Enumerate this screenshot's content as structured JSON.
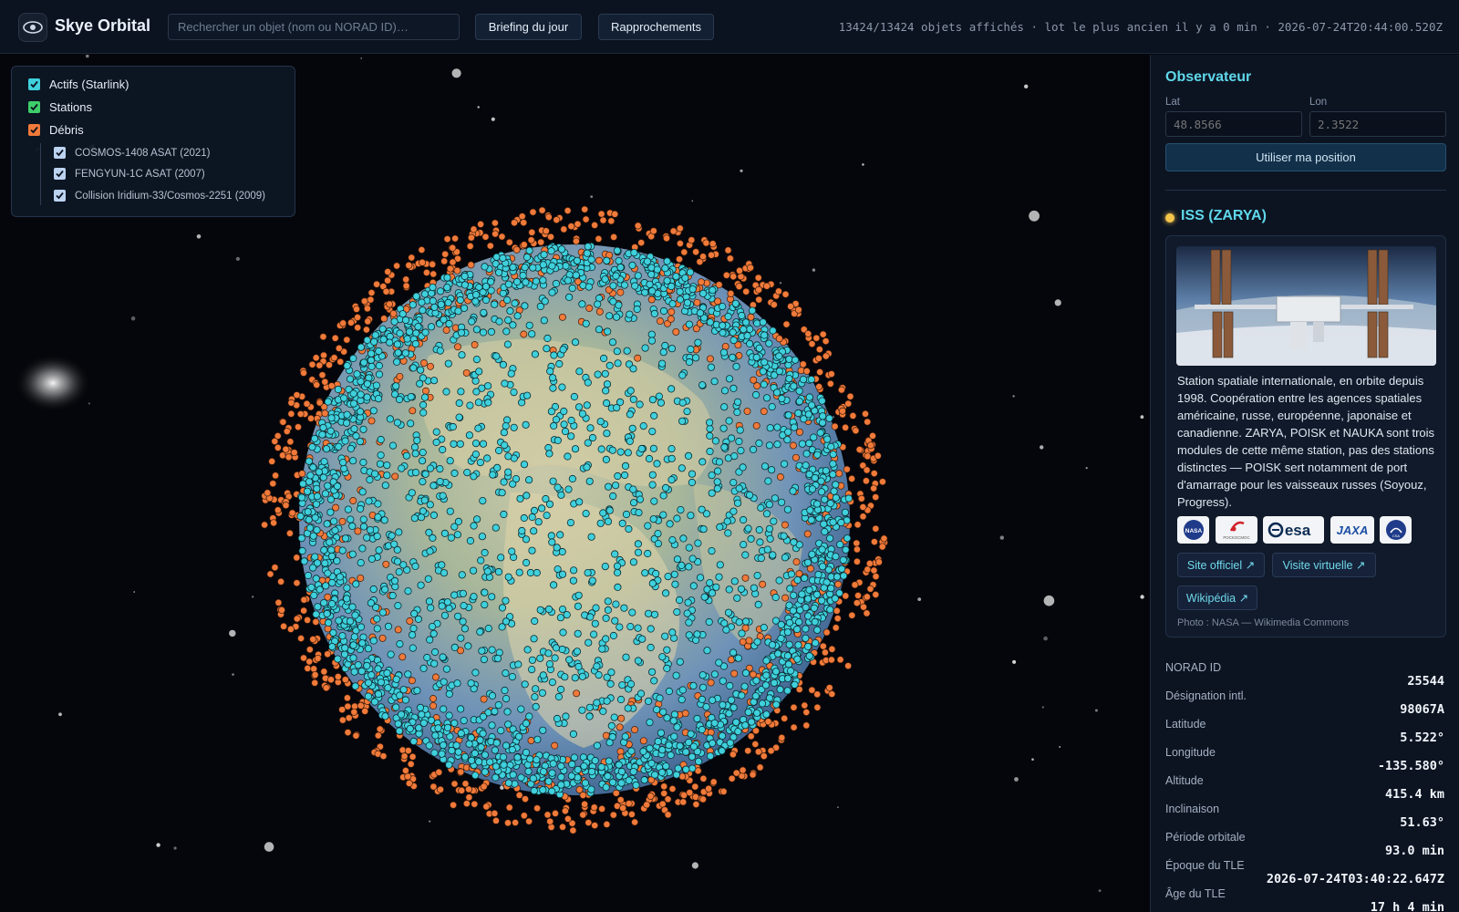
{
  "app": {
    "title": "Skye Orbital",
    "logo_icon": "eye-icon"
  },
  "search": {
    "placeholder": "Rechercher un objet (nom ou NORAD ID)…"
  },
  "toolbar": {
    "briefing_label": "Briefing du jour",
    "approaches_label": "Rapprochements"
  },
  "status": {
    "text": "13424/13424 objets affichés · lot le plus ancien il y a 0 min · 2026-07-24T20:44:00.520Z"
  },
  "layers": {
    "items": [
      {
        "label": "Actifs (Starlink)",
        "checked": true,
        "color": "#3fd0dc"
      },
      {
        "label": "Stations",
        "checked": true,
        "color": "#3fce6a"
      },
      {
        "label": "Débris",
        "checked": true,
        "color": "#f07a3a"
      }
    ],
    "debris_events": [
      {
        "label": "COSMOS-1408 ASAT (2021)",
        "checked": true
      },
      {
        "label": "FENGYUN-1C ASAT (2007)",
        "checked": true
      },
      {
        "label": "Collision Iridium-33/Cosmos-2251 (2009)",
        "checked": true
      }
    ]
  },
  "colors": {
    "active": "#3fd0dc",
    "debris": "#f07a3a",
    "accent": "#5fd8ea",
    "selected_dot": "#f6c54a"
  },
  "observer": {
    "title": "Observateur",
    "lat_label": "Lat",
    "lon_label": "Lon",
    "lat_placeholder": "48.8566",
    "lon_placeholder": "2.3522",
    "use_position_label": "Utiliser ma position"
  },
  "selected": {
    "name": "ISS (ZARYA)",
    "description": "Station spatiale internationale, en orbite depuis 1998. Coopération entre les agences spatiales américaine, russe, européenne, japonaise et canadienne. ZARYA, POISK et NAUKA sont trois modules de cette même station, pas des stations distinctes — POISK sert notamment de port d'amarrage pour les vaisseaux russes (Soyouz, Progress).",
    "agencies": [
      {
        "name": "NASA",
        "icon": "nasa-logo"
      },
      {
        "name": "POCKOCMOC",
        "icon": "roscosmos-logo"
      },
      {
        "name": "esa",
        "icon": "esa-logo"
      },
      {
        "name": "JAXA",
        "icon": "jaxa-logo"
      },
      {
        "name": "CSA",
        "icon": "csa-logo"
      }
    ],
    "links": {
      "official": "Site officiel ↗",
      "virtual_tour": "Visite virtuelle ↗",
      "wikipedia": "Wikipédia ↗"
    },
    "photo_credit": "Photo : NASA — Wikimedia Commons",
    "details": [
      {
        "label": "NORAD ID",
        "value": "25544"
      },
      {
        "label": "Désignation intl.",
        "value": "98067A"
      },
      {
        "label": "Latitude",
        "value": "5.522°"
      },
      {
        "label": "Longitude",
        "value": "-135.580°"
      },
      {
        "label": "Altitude",
        "value": "415.4 km"
      },
      {
        "label": "Inclinaison",
        "value": "51.63°"
      },
      {
        "label": "Période orbitale",
        "value": "93.0 min"
      },
      {
        "label": "Époque du TLE",
        "value": "2026-07-24T03:40:22.647Z"
      },
      {
        "label": "Âge du TLE",
        "value": "17 h 4 min"
      }
    ]
  }
}
